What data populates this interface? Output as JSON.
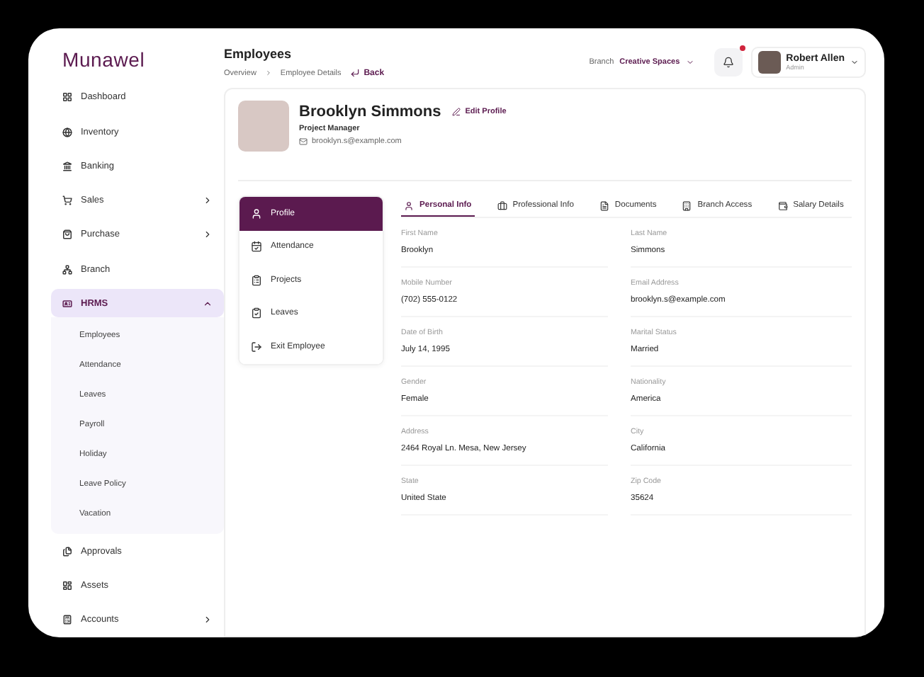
{
  "logo": {
    "text": "Munawel"
  },
  "sidebar": {
    "items": [
      {
        "label": "Dashboard",
        "selected": false
      },
      {
        "label": "Inventory",
        "selected": false
      },
      {
        "label": "Banking",
        "selected": false
      },
      {
        "label": "Sales",
        "selected": false,
        "expanded": false
      },
      {
        "label": "Purchase",
        "selected": false,
        "expanded": false
      },
      {
        "label": "Branch",
        "selected": false
      },
      {
        "label": "HRMS",
        "selected": true,
        "expanded": true,
        "children": [
          {
            "label": "Employees",
            "selected": false
          },
          {
            "label": "Attendance",
            "selected": false
          },
          {
            "label": "Leaves",
            "selected": false
          },
          {
            "label": "Payroll",
            "selected": false
          },
          {
            "label": "Holiday",
            "selected": false
          },
          {
            "label": "Leave Policy",
            "selected": false
          },
          {
            "label": "Vacation",
            "selected": false
          }
        ]
      },
      {
        "label": "Approvals",
        "selected": false
      },
      {
        "label": "Assets",
        "selected": false
      },
      {
        "label": "Accounts",
        "selected": false,
        "expanded": false
      }
    ]
  },
  "header": {
    "title": "Employees",
    "breadcrumb": [
      "Overview",
      "Employee Details"
    ],
    "back": "Back",
    "branch_label": "Branch",
    "branch_value": "Creative Spaces",
    "notification_dot": true,
    "user": {
      "name": "Robert Allen",
      "role": "Admin"
    }
  },
  "profile": {
    "name": "Brooklyn Simmons",
    "edit": "Edit Profile",
    "role": "Project Manager",
    "email": "brooklyn.s@example.com"
  },
  "profile_menu": [
    {
      "label": "Profile",
      "selected": true
    },
    {
      "label": "Attendance",
      "selected": false
    },
    {
      "label": "Projects",
      "selected": false
    },
    {
      "label": "Leaves",
      "selected": false
    },
    {
      "label": "Exit Employee",
      "selected": false
    }
  ],
  "tabs": [
    {
      "label": "Personal Info",
      "selected": true
    },
    {
      "label": "Professional Info",
      "selected": false
    },
    {
      "label": "Documents",
      "selected": false
    },
    {
      "label": "Branch Access",
      "selected": false
    },
    {
      "label": "Salary Details",
      "selected": false
    }
  ],
  "fields": [
    {
      "label": "First Name",
      "value": "Brooklyn"
    },
    {
      "label": "Last Name",
      "value": "Simmons"
    },
    {
      "label": "Mobile Number",
      "value": "(702) 555-0122"
    },
    {
      "label": "Email Address",
      "value": "brooklyn.s@example.com"
    },
    {
      "label": "Date of Birth",
      "value": "July 14, 1995"
    },
    {
      "label": "Marital Status",
      "value": "Married"
    },
    {
      "label": "Gender",
      "value": "Female"
    },
    {
      "label": "Nationality",
      "value": "America"
    },
    {
      "label": "Address",
      "value": "2464 Royal Ln. Mesa, New Jersey"
    },
    {
      "label": "City",
      "value": "California"
    },
    {
      "label": "State",
      "value": "United State"
    },
    {
      "label": "Zip Code",
      "value": "35624"
    }
  ]
}
